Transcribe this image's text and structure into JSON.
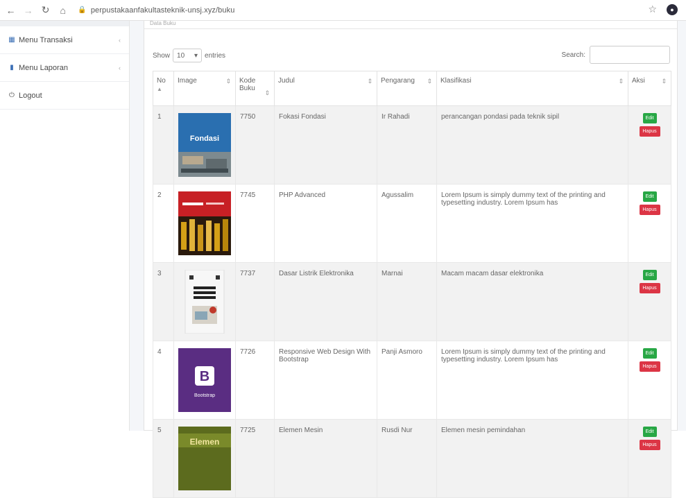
{
  "browser": {
    "url": "perpustakaanfakultasteknik-unsj.xyz/buku"
  },
  "sidebar": {
    "items": [
      {
        "label": "Menu Transaksi"
      },
      {
        "label": "Menu Laporan"
      },
      {
        "label": "Logout"
      }
    ]
  },
  "card": {
    "header": "Data Buku"
  },
  "controls": {
    "show_label": "Show",
    "entries_value": "10",
    "entries_label": "entries",
    "search_label": "Search:"
  },
  "table": {
    "headers": [
      "No",
      "Image",
      "Kode Buku",
      "Judul",
      "Pengarang",
      "Klasifikasi",
      "Aksi"
    ],
    "edit_label": "Edit",
    "delete_label": "Hapus",
    "rows": [
      {
        "no": "1",
        "cover_text": "Fondasi",
        "kode": "7750",
        "judul": "Fokasi Fondasi",
        "pengarang": "Ir Rahadi",
        "klasifikasi": "perancangan pondasi pada teknik sipil"
      },
      {
        "no": "2",
        "cover_text": "PHP Advanced",
        "kode": "7745",
        "judul": "PHP Advanced",
        "pengarang": "Agussalim",
        "klasifikasi": "Lorem Ipsum is simply dummy text of the printing and typesetting industry. Lorem Ipsum has"
      },
      {
        "no": "3",
        "cover_text": "Dasar Listrik & Elektronika",
        "kode": "7737",
        "judul": "Dasar Listrik Elektronika",
        "pengarang": "Marnai",
        "klasifikasi": "Macam macam dasar elektronika"
      },
      {
        "no": "4",
        "cover_text": "Bootstrap",
        "kode": "7726",
        "judul": "Responsive Web Design With Bootstrap",
        "pengarang": "Panji Asmoro",
        "klasifikasi": "Lorem Ipsum is simply dummy text of the printing and typesetting industry. Lorem Ipsum has"
      },
      {
        "no": "5",
        "cover_text": "Elemen",
        "kode": "7725",
        "judul": "Elemen Mesin",
        "pengarang": "Rusdi Nur",
        "klasifikasi": "Elemen mesin pemindahan"
      }
    ]
  }
}
